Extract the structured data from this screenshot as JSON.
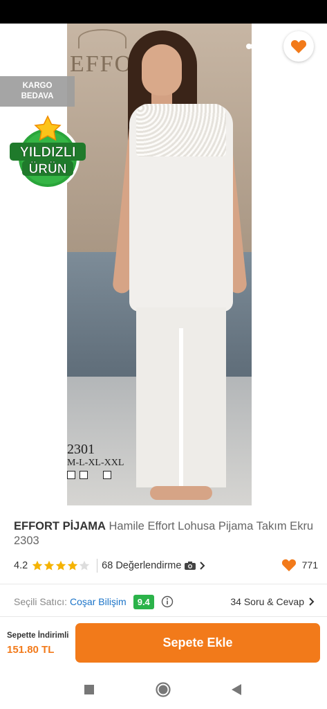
{
  "header": {
    "back_icon": "arrow-left-icon",
    "share_icon": "share-icon",
    "favorite_icon": "heart-icon"
  },
  "badges": {
    "kargo_line1": "KARGO",
    "kargo_line2": "BEDAVA",
    "star_line1": "YILDIZLI",
    "star_line2": "ÜRÜN"
  },
  "photo": {
    "brand_text": "EFFORTT",
    "model_code": "2301",
    "model_sizes": "M-L-XL-XXL"
  },
  "product": {
    "brand": "EFFORT PİJAMA",
    "name": "Hamile Effort Lohusa Pijama Takım Ekru 2303"
  },
  "rating": {
    "value": "4.2",
    "stars": 4.2,
    "reviews": "68 Değerlendirme",
    "favorites": "771"
  },
  "seller": {
    "label": "Seçili Satıcı:",
    "name": "Coşar Bilişim",
    "score": "9.4",
    "qa": "34 Soru & Cevap"
  },
  "cart": {
    "discount_label": "Sepette İndirimli",
    "price": "151.80 TL",
    "button": "Sepete Ekle"
  },
  "colors": {
    "accent": "#f27a1a",
    "seller_score": "#2bb34a",
    "link": "#1a73c8",
    "star": "#f5b301"
  }
}
